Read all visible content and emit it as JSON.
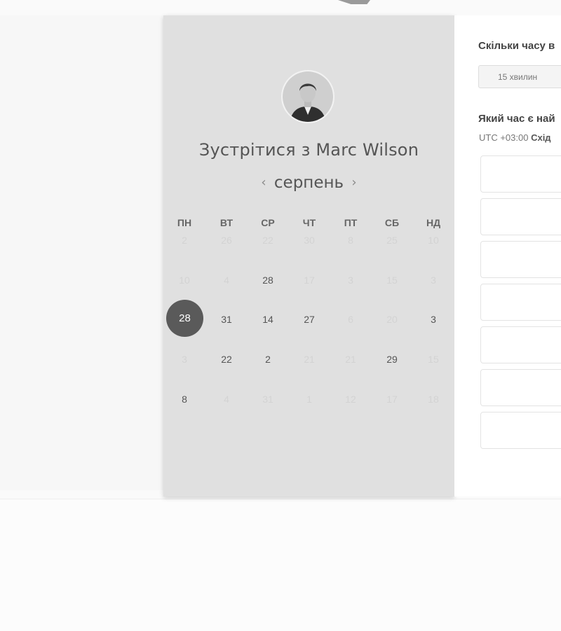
{
  "header": {
    "meet_title": "Зустрітися з Marc Wilson"
  },
  "calendar": {
    "month": "серпень",
    "prev_icon": "‹",
    "next_icon": "›",
    "weekdays": [
      "ПН",
      "ВТ",
      "СР",
      "ЧТ",
      "ПТ",
      "СБ",
      "НД"
    ],
    "weeks": [
      [
        {
          "d": "2",
          "active": false
        },
        {
          "d": "26",
          "active": false
        },
        {
          "d": "22",
          "active": false
        },
        {
          "d": "30",
          "active": false
        },
        {
          "d": "8",
          "active": false
        },
        {
          "d": "25",
          "active": false
        },
        {
          "d": "10",
          "active": false
        }
      ],
      [
        {
          "d": "10",
          "active": false
        },
        {
          "d": "4",
          "active": false
        },
        {
          "d": "28",
          "active": true
        },
        {
          "d": "17",
          "active": false
        },
        {
          "d": "3",
          "active": false
        },
        {
          "d": "15",
          "active": false
        },
        {
          "d": "3",
          "active": false
        }
      ],
      [
        {
          "d": "28",
          "active": true,
          "selected": true
        },
        {
          "d": "31",
          "active": true
        },
        {
          "d": "14",
          "active": true
        },
        {
          "d": "27",
          "active": true
        },
        {
          "d": "6",
          "active": false
        },
        {
          "d": "20",
          "active": false
        },
        {
          "d": "3",
          "active": true
        }
      ],
      [
        {
          "d": "3",
          "active": false
        },
        {
          "d": "22",
          "active": true
        },
        {
          "d": "2",
          "active": true
        },
        {
          "d": "21",
          "active": false
        },
        {
          "d": "21",
          "active": false
        },
        {
          "d": "29",
          "active": true
        },
        {
          "d": "15",
          "active": false
        }
      ],
      [
        {
          "d": "8",
          "active": true
        },
        {
          "d": "4",
          "active": false
        },
        {
          "d": "31",
          "active": false
        },
        {
          "d": "1",
          "active": false
        },
        {
          "d": "12",
          "active": false
        },
        {
          "d": "17",
          "active": false
        },
        {
          "d": "18",
          "active": false
        }
      ]
    ]
  },
  "booking": {
    "duration_heading": "Скільки часу в",
    "duration_option": "15 хвилин",
    "time_heading": "Який час є най",
    "timezone_prefix": "UTC +03:00",
    "timezone_name": "Схід",
    "slot_count": 7
  }
}
